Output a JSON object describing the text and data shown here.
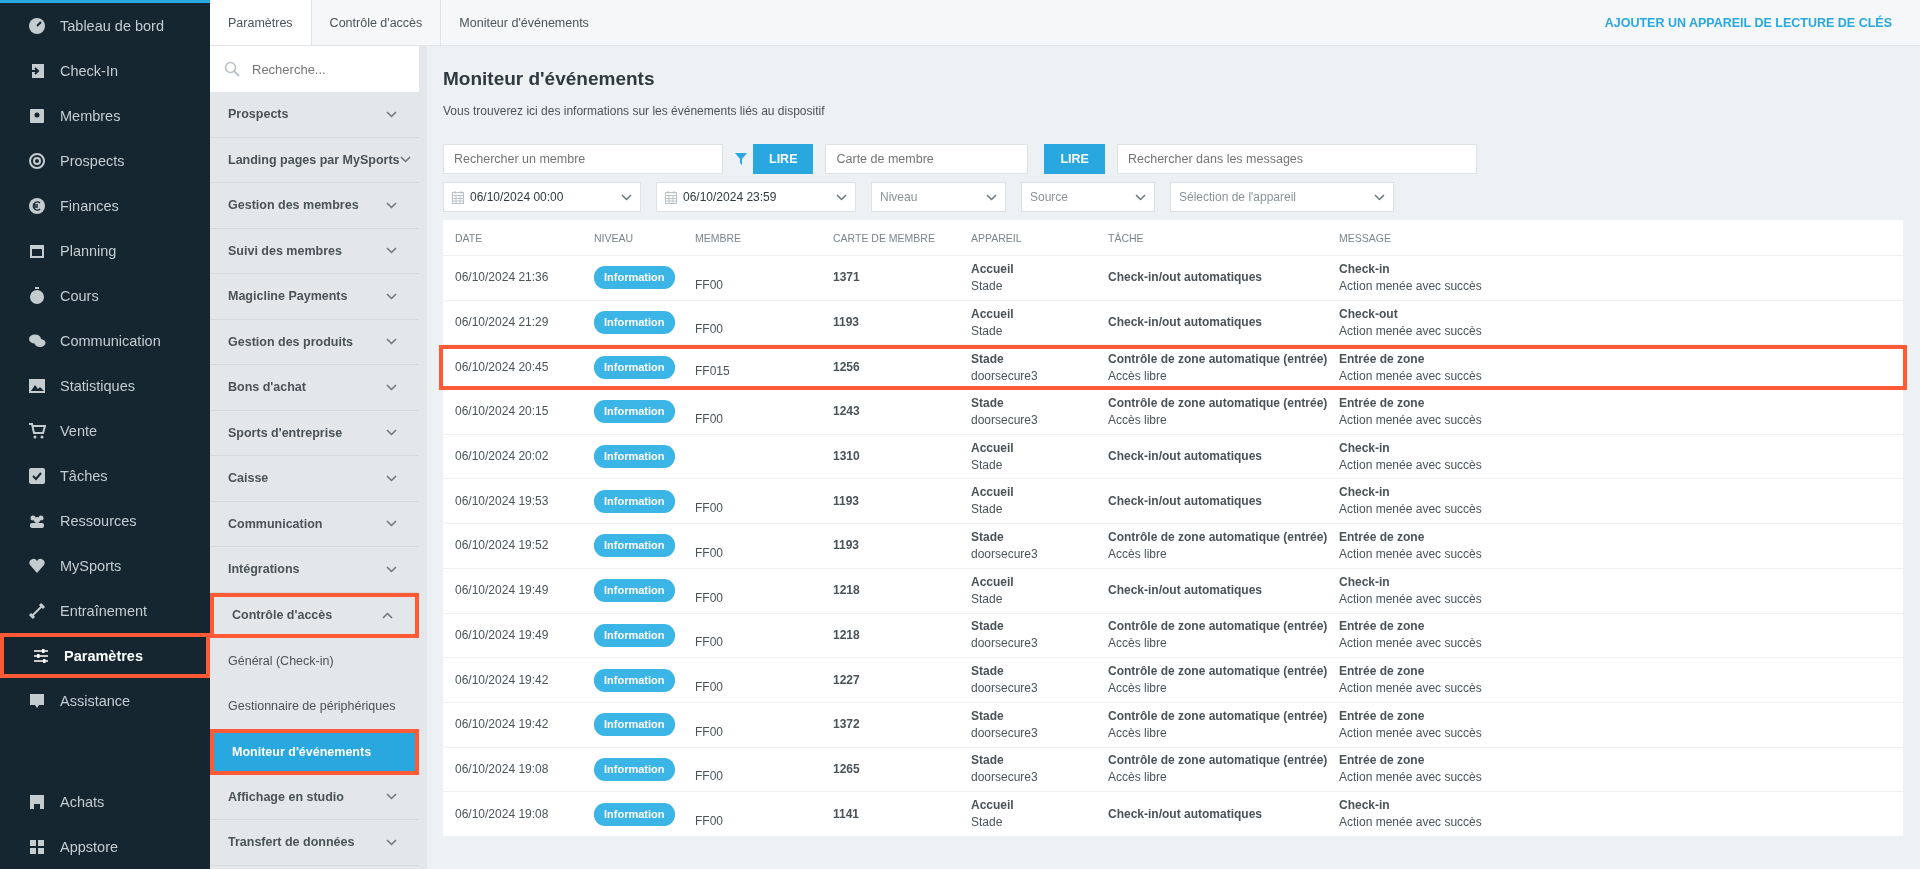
{
  "nav": {
    "items": [
      {
        "label": "Tableau de bord",
        "selected": false,
        "highlighted": false
      },
      {
        "label": "Check-In",
        "selected": false,
        "highlighted": false
      },
      {
        "label": "Membres",
        "selected": false,
        "highlighted": false
      },
      {
        "label": "Prospects",
        "selected": false,
        "highlighted": false
      },
      {
        "label": "Finances",
        "selected": false,
        "highlighted": false
      },
      {
        "label": "Planning",
        "selected": false,
        "highlighted": false
      },
      {
        "label": "Cours",
        "selected": false,
        "highlighted": false
      },
      {
        "label": "Communication",
        "selected": false,
        "highlighted": false
      },
      {
        "label": "Statistiques",
        "selected": false,
        "highlighted": false
      },
      {
        "label": "Vente",
        "selected": false,
        "highlighted": false
      },
      {
        "label": "Tâches",
        "selected": false,
        "highlighted": false
      },
      {
        "label": "Ressources",
        "selected": false,
        "highlighted": false
      },
      {
        "label": "MySports",
        "selected": false,
        "highlighted": false
      },
      {
        "label": "Entraînement",
        "selected": false,
        "highlighted": false
      },
      {
        "label": "Paramètres",
        "selected": true,
        "highlighted": true
      },
      {
        "label": "Assistance",
        "selected": false,
        "highlighted": false
      }
    ],
    "bottom_items": [
      {
        "label": "Achats",
        "selected": false
      },
      {
        "label": "Appstore",
        "selected": false
      }
    ]
  },
  "breadcrumb": [
    "Paramètres",
    "Contrôle d'accès",
    "Moniteur d'événements"
  ],
  "header_action": "AJOUTER UN APPAREIL DE LECTURE DE CLÉS",
  "settings": {
    "search": {
      "placeholder": "Recherche..."
    },
    "sections": [
      {
        "label": "Prospects",
        "expanded": false,
        "highlighted": false
      },
      {
        "label": "Landing pages par MySports",
        "expanded": false,
        "highlighted": false
      },
      {
        "label": "Gestion des membres",
        "expanded": false,
        "highlighted": false
      },
      {
        "label": "Suivi des membres",
        "expanded": false,
        "highlighted": false
      },
      {
        "label": "Magicline Payments",
        "expanded": false,
        "highlighted": false
      },
      {
        "label": "Gestion des produits",
        "expanded": false,
        "highlighted": false
      },
      {
        "label": "Bons d'achat",
        "expanded": false,
        "highlighted": false
      },
      {
        "label": "Sports d'entreprise",
        "expanded": false,
        "highlighted": false
      },
      {
        "label": "Caisse",
        "expanded": false,
        "highlighted": false
      },
      {
        "label": "Communication",
        "expanded": false,
        "highlighted": false
      },
      {
        "label": "Intégrations",
        "expanded": false,
        "highlighted": false
      },
      {
        "label": "Contrôle d'accès",
        "expanded": true,
        "highlighted": true,
        "children": [
          {
            "label": "Général (Check-in)",
            "selected": false,
            "highlighted": false
          },
          {
            "label": "Gestionnaire de périphériques",
            "selected": false,
            "highlighted": false
          },
          {
            "label": "Moniteur d'événements",
            "selected": true,
            "highlighted": true
          }
        ]
      },
      {
        "label": "Affichage en studio",
        "expanded": false,
        "highlighted": false
      },
      {
        "label": "Transfert de données",
        "expanded": false,
        "highlighted": false
      }
    ]
  },
  "page": {
    "title": "Moniteur d'événements",
    "subtitle": "Vous trouverez ici des informations sur les événements liés au dispositif"
  },
  "filters": {
    "member_search": {
      "placeholder": "Rechercher un membre"
    },
    "read_button_1": "LIRE",
    "card_field": {
      "placeholder": "Carte de membre"
    },
    "read_button_2": "LIRE",
    "message_search": {
      "placeholder": "Rechercher dans les messages"
    },
    "date_from": "06/10/2024 00:00",
    "date_to": "06/10/2024 23:59",
    "level_select": {
      "placeholder": "Niveau"
    },
    "source_select": {
      "placeholder": "Source"
    },
    "device_select": {
      "placeholder": "Sélection de l'appareil"
    }
  },
  "table": {
    "columns": [
      "DATE",
      "NIVEAU",
      "MEMBRE",
      "CARTE DE MEMBRE",
      "APPAREIL",
      "TÂCHE",
      "MESSAGE"
    ],
    "rows": [
      {
        "date": "06/10/2024 21:36",
        "level": "Information",
        "member": "FF00",
        "card": "1371",
        "device": "Accueil",
        "device_sub": "Stade",
        "task": "Check-in/out automatiques",
        "message": "Check-in",
        "message_sub": "Action menée avec succès",
        "highlighted": false
      },
      {
        "date": "06/10/2024 21:29",
        "level": "Information",
        "member": "FF00",
        "card": "1193",
        "device": "Accueil",
        "device_sub": "Stade",
        "task": "Check-in/out automatiques",
        "message": "Check-out",
        "message_sub": "Action menée avec succès",
        "highlighted": false
      },
      {
        "date": "06/10/2024 20:45",
        "level": "Information",
        "member": "FF015",
        "card": "1256",
        "device": "Stade",
        "device_sub": "doorsecure3",
        "task": "Contrôle de zone automatique (entrée)",
        "task_sub": "Accès libre",
        "message": "Entrée de zone",
        "message_sub": "Action menée avec succès",
        "highlighted": true
      },
      {
        "date": "06/10/2024 20:15",
        "level": "Information",
        "member": "FF00",
        "card": "1243",
        "device": "Stade",
        "device_sub": "doorsecure3",
        "task": "Contrôle de zone automatique (entrée)",
        "task_sub": "Accès libre",
        "message": "Entrée de zone",
        "message_sub": "Action menée avec succès",
        "highlighted": false
      },
      {
        "date": "06/10/2024 20:02",
        "level": "Information",
        "card": "1310",
        "device": "Accueil",
        "device_sub": "Stade",
        "task": "Check-in/out automatiques",
        "message": "Check-in",
        "message_sub": "Action menée avec succès",
        "highlighted": false
      },
      {
        "date": "06/10/2024 19:53",
        "level": "Information",
        "member": "FF00",
        "card": "1193",
        "device": "Accueil",
        "device_sub": "Stade",
        "task": "Check-in/out automatiques",
        "message": "Check-in",
        "message_sub": "Action menée avec succès",
        "highlighted": false
      },
      {
        "date": "06/10/2024 19:52",
        "level": "Information",
        "member": "FF00",
        "card": "1193",
        "device": "Stade",
        "device_sub": "doorsecure3",
        "task": "Contrôle de zone automatique (entrée)",
        "task_sub": "Accès libre",
        "message": "Entrée de zone",
        "message_sub": "Action menée avec succès",
        "highlighted": false
      },
      {
        "date": "06/10/2024 19:49",
        "level": "Information",
        "member": "FF00",
        "card": "1218",
        "device": "Accueil",
        "device_sub": "Stade",
        "task": "Check-in/out automatiques",
        "message": "Check-in",
        "message_sub": "Action menée avec succès",
        "highlighted": false
      },
      {
        "date": "06/10/2024 19:49",
        "level": "Information",
        "member": "FF00",
        "card": "1218",
        "device": "Stade",
        "device_sub": "doorsecure3",
        "task": "Contrôle de zone automatique (entrée)",
        "task_sub": "Accès libre",
        "message": "Entrée de zone",
        "message_sub": "Action menée avec succès",
        "highlighted": false
      },
      {
        "date": "06/10/2024 19:42",
        "level": "Information",
        "member": "FF00",
        "card": "1227",
        "device": "Stade",
        "device_sub": "doorsecure3",
        "task": "Contrôle de zone automatique (entrée)",
        "task_sub": "Accès libre",
        "message": "Entrée de zone",
        "message_sub": "Action menée avec succès",
        "highlighted": false
      },
      {
        "date": "06/10/2024 19:42",
        "level": "Information",
        "member": "FF00",
        "card": "1372",
        "device": "Stade",
        "device_sub": "doorsecure3",
        "task": "Contrôle de zone automatique (entrée)",
        "task_sub": "Accès libre",
        "message": "Entrée de zone",
        "message_sub": "Action menée avec succès",
        "highlighted": false
      },
      {
        "date": "06/10/2024 19:08",
        "level": "Information",
        "member": "FF00",
        "card": "1265",
        "device": "Stade",
        "device_sub": "doorsecure3",
        "task": "Contrôle de zone automatique (entrée)",
        "task_sub": "Accès libre",
        "message": "Entrée de zone",
        "message_sub": "Action menée avec succès",
        "highlighted": false
      },
      {
        "date": "06/10/2024 19:08",
        "level": "Information",
        "member": "FF00",
        "card": "1141",
        "device": "Accueil",
        "device_sub": "Stade",
        "task": "Check-in/out automatiques",
        "message": "Check-in",
        "message_sub": "Action menée avec succès",
        "highlighted": false
      }
    ]
  }
}
